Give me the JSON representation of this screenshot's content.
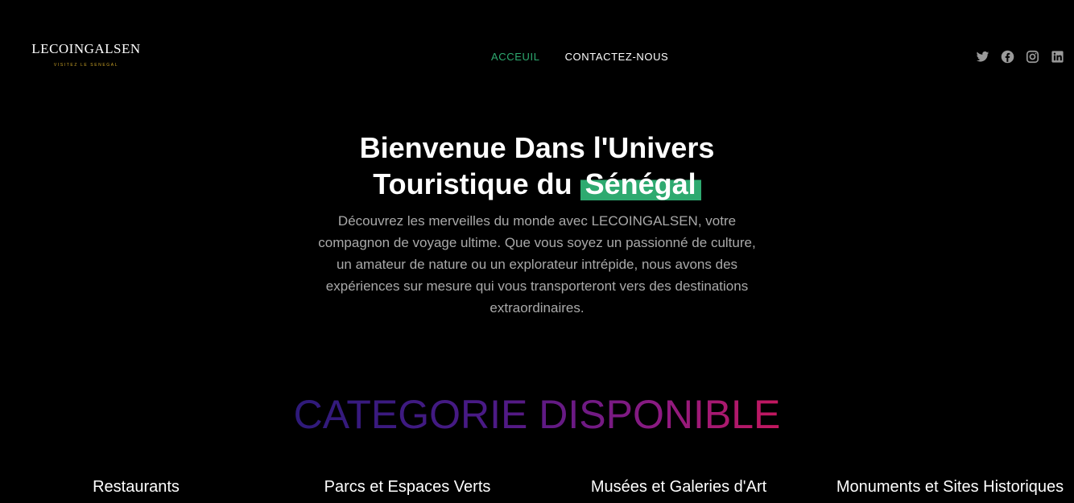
{
  "brand": {
    "name": "LECOINGALSEN",
    "tagline": "VISITEZ LE SENEGAL",
    "tagline_color": "#c9a227"
  },
  "nav": {
    "items": [
      {
        "label": "ACCEUIL",
        "active": true
      },
      {
        "label": "CONTACTEZ-NOUS",
        "active": false
      }
    ],
    "active_color": "#2eaa70"
  },
  "socials": [
    "twitter-icon",
    "facebook-icon",
    "instagram-icon",
    "linkedin-icon"
  ],
  "hero": {
    "title_line1": "Bienvenue Dans l'Univers",
    "title_line2": "Touristique du",
    "title_highlight": "Sénégal",
    "highlight_color": "#2eaa70",
    "description": "Découvrez les merveilles du monde avec LECOINGALSEN, votre compagnon de voyage ultime. Que vous soyez un passionné de culture, un amateur de nature ou un explorateur intrépide, nous avons des expériences sur mesure qui vous transporteront vers des destinations extraordinaires."
  },
  "categories": {
    "title": "CATEGORIE DISPONIBLE",
    "items": [
      "Restaurants",
      "Parcs et Espaces Verts",
      "Musées et Galeries d'Art",
      "Monuments et Sites Historiques"
    ]
  }
}
